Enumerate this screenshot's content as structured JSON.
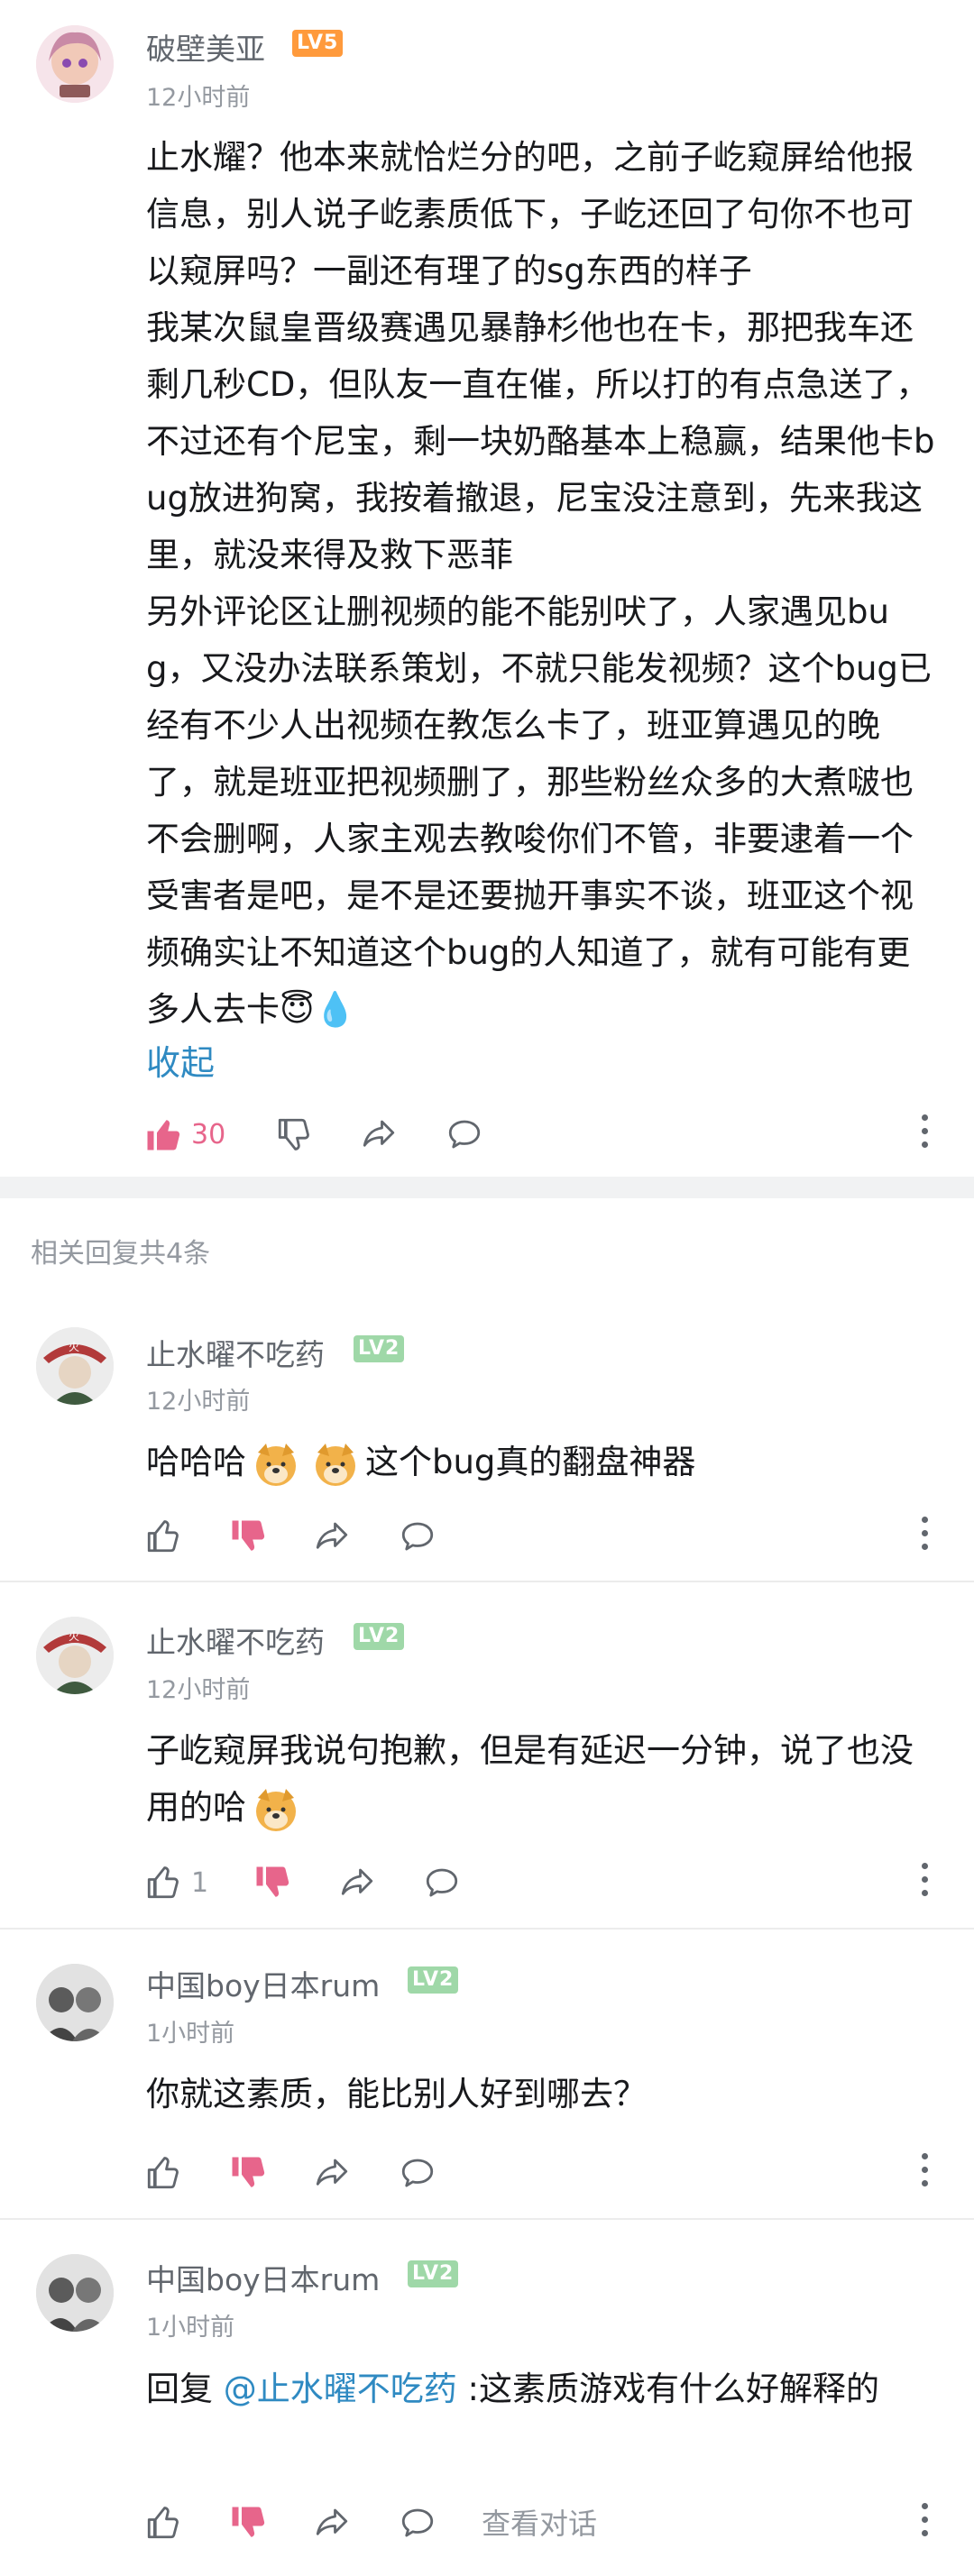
{
  "main_comment": {
    "username": "破壁美亚",
    "level": "LV5",
    "time": "12小时前",
    "paragraphs": [
      "止水耀？他本来就恰烂分的吧，之前子屹窥屏给他报信息，别人说子屹素质低下，子屹还回了句你不也可以窥屏吗？一副还有理了的sg东西的样子",
      "我某次鼠皇晋级赛遇见暴静杉他也在卡，那把我车还剩几秒CD，但队友一直在催，所以打的有点急送了，不过还有个尼宝，剩一块奶酪基本上稳赢，结果他卡bug放进狗窝，我按着撤退，尼宝没注意到，先来我这里，就没来得及救下恶菲",
      "另外评论区让删视频的能不能别吠了，人家遇见bug，又没办法联系策划，不就只能发视频？这个bug已经有不少人出视频在教怎么卡了，班亚算遇见的晚了，就是班亚把视频删了，那些粉丝众多的大煮啵也不会删啊，人家主观去教唆你们不管，非要逮着一个受害者是吧，是不是还要抛开事实不谈，班亚这个视频确实让不知道这个bug的人知道了，就有可能有更多人去卡😇💧"
    ],
    "fold_label": "收起",
    "like_count": "30"
  },
  "replies_header": "相关回复共4条",
  "replies": [
    {
      "username": "止水曜不吃药",
      "level": "LV2",
      "time": "12小时前",
      "text_a": "哈哈哈",
      "text_b": "这个bug真的翻盘神器",
      "like_count": ""
    },
    {
      "username": "止水曜不吃药",
      "level": "LV2",
      "time": "12小时前",
      "text_a": "子屹窥屏我说句抱歉，但是有延迟一分钟，说了也没用的哈",
      "like_count": "1"
    },
    {
      "username": "中国boy日本rum",
      "level": "LV2",
      "time": "1小时前",
      "text_a": "你就这素质，能比别人好到哪去？",
      "like_count": ""
    },
    {
      "username": "中国boy日本rum",
      "level": "LV2",
      "time": "1小时前",
      "reply_prefix": "回复 ",
      "mention": "@止水曜不吃药",
      "text_a": " :这素质游戏有什么好解释的",
      "like_count": "",
      "view_conversation": "查看对话"
    }
  ],
  "colors": {
    "accent_pink": "#e7658b",
    "link_blue": "#2f8ac2",
    "level5": "#ff9a3c",
    "level2": "#9fd8a8"
  },
  "icons": [
    "thumb-up-icon",
    "thumb-down-icon",
    "share-icon",
    "comment-icon",
    "more-icon",
    "doge-emoji"
  ]
}
